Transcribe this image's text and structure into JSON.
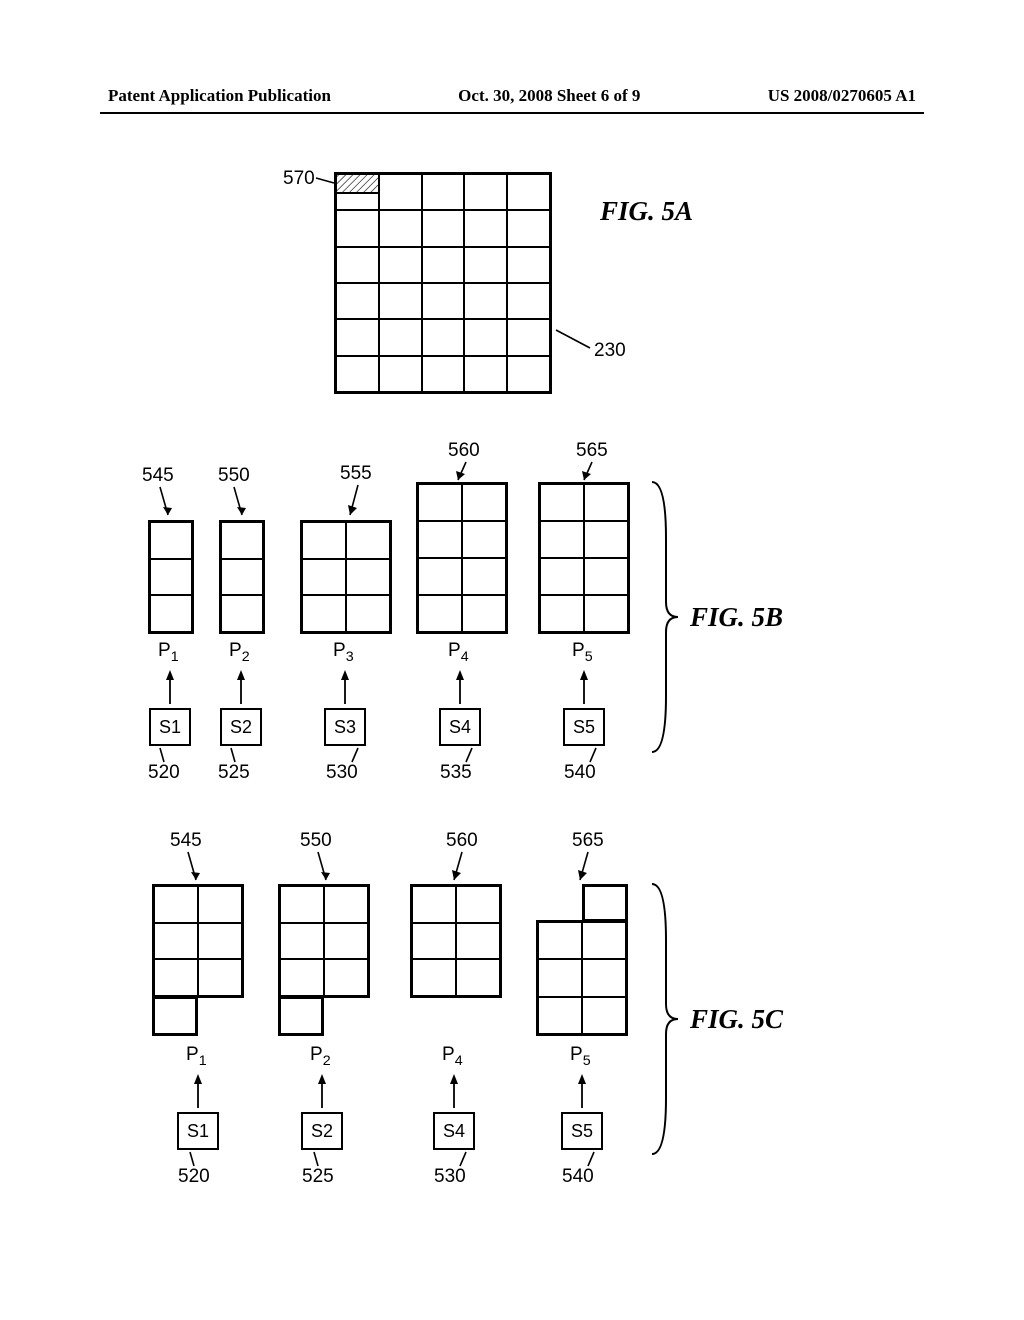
{
  "header": {
    "left": "Patent Application Publication",
    "center": "Oct. 30, 2008  Sheet 6 of 9",
    "right": "US 2008/0270605 A1"
  },
  "fig5a": {
    "label": "FIG. 5A",
    "ref_570": "570",
    "ref_230": "230"
  },
  "fig5b": {
    "label": "FIG. 5B",
    "refs": {
      "r545": "545",
      "r550": "550",
      "r555": "555",
      "r560": "560",
      "r565": "565",
      "r520": "520",
      "r525": "525",
      "r530": "530",
      "r535": "535",
      "r540": "540"
    },
    "p": {
      "p1": "P",
      "p1s": "1",
      "p2": "P",
      "p2s": "2",
      "p3": "P",
      "p3s": "3",
      "p4": "P",
      "p4s": "4",
      "p5": "P",
      "p5s": "5"
    },
    "s": {
      "s1": "S1",
      "s2": "S2",
      "s3": "S3",
      "s4": "S4",
      "s5": "S5"
    }
  },
  "fig5c": {
    "label": "FIG. 5C",
    "refs": {
      "r545": "545",
      "r550": "550",
      "r560": "560",
      "r565": "565",
      "r520": "520",
      "r525": "525",
      "r530": "530",
      "r540": "540"
    },
    "p": {
      "p1": "P",
      "p1s": "1",
      "p2": "P",
      "p2s": "2",
      "p4": "P",
      "p4s": "4",
      "p5": "P",
      "p5s": "5"
    },
    "s": {
      "s1": "S1",
      "s2": "S2",
      "s4": "S4",
      "s5": "S5"
    }
  }
}
